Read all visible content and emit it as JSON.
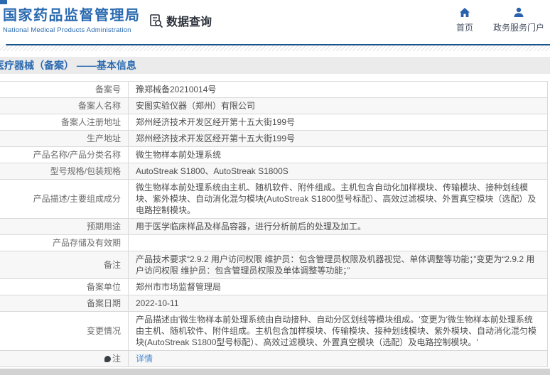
{
  "header": {
    "brand_cn": "国家药品监督管理局",
    "brand_en": "National Medical Products Administration",
    "section_title": "数据查询",
    "nav": [
      {
        "label": "首页",
        "icon": "home-icon"
      },
      {
        "label": "政务服务门户",
        "icon": "user-icon"
      }
    ]
  },
  "breadcrumb": "医疗器械（备案） ——基本信息",
  "table": {
    "rows": [
      {
        "label": "备案号",
        "value": "豫郑械备20210014号"
      },
      {
        "label": "备案人名称",
        "value": "安图实验仪器（郑州）有限公司"
      },
      {
        "label": "备案人注册地址",
        "value": "郑州经济技术开发区经开第十五大街199号"
      },
      {
        "label": "生产地址",
        "value": "郑州经济技术开发区经开第十五大街199号"
      },
      {
        "label": "产品名称/产品分类名称",
        "value": "微生物样本前处理系统"
      },
      {
        "label": "型号规格/包装规格",
        "value": "AutoStreak S1800、AutoStreak S1800S"
      },
      {
        "label": "产品描述/主要组成成分",
        "value": "微生物样本前处理系统由主机、随机软件、附件组成。主机包含自动化加样模块、传输模块、接种划线模块、紫外模块、自动消化混匀模块(AutoStreak S1800型号标配）、高效过滤模块、外置真空模块（选配）及电路控制模块。"
      },
      {
        "label": "预期用途",
        "value": "用于医学临床样品及样品容器，进行分析前后的处理及加工。"
      },
      {
        "label": "产品存储及有效期",
        "value": ""
      },
      {
        "label": "备注",
        "value": "产品技术要求“2.9.2 用户访问权限 维护员：包含管理员权限及机器视觉、单体调整等功能；”变更为“2.9.2 用户访问权限 维护员：包含管理员权限及单体调整等功能；”"
      },
      {
        "label": "备案单位",
        "value": "郑州市市场监督管理局"
      },
      {
        "label": "备案日期",
        "value": "2022-10-11"
      },
      {
        "label": "变更情况",
        "value": "产品描述由'微生物样本前处理系统由自动接种、自动分区划线等模块组成。'变更为'微生物样本前处理系统由主机、随机软件、附件组成。主机包含加样模块、传输模块、接种划线模块、紫外模块、自动消化混匀模块(AutoStreak S1800型号标配）、高效过滤模块、外置真空模块（选配）及电路控制模块。'"
      },
      {
        "label": "注",
        "label_icon": "note-icon",
        "value": "详情",
        "is_link": true
      }
    ]
  },
  "colors": {
    "brand_blue": "#2a6ab0",
    "icon_blue": "#2b62ad",
    "link_blue": "#4a89d0",
    "navy_line": "#17548c",
    "row_alt_bg": "#f7f7f7",
    "breadcrumb_bg": "#ebebeb"
  }
}
